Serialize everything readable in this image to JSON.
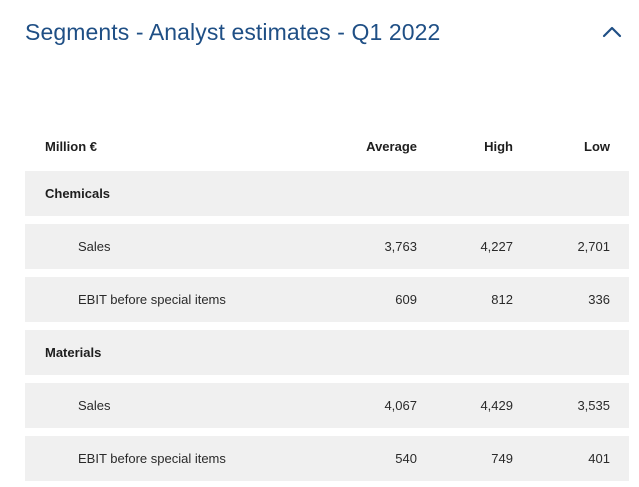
{
  "title": "Segments - Analyst estimates - Q1 2022",
  "table": {
    "headers": {
      "label": "Million €",
      "average": "Average",
      "high": "High",
      "low": "Low"
    },
    "groups": [
      {
        "name": "Chemicals",
        "rows": [
          {
            "label": "Sales",
            "average": "3,763",
            "high": "4,227",
            "low": "2,701"
          },
          {
            "label": "EBIT before special items",
            "average": "609",
            "high": "812",
            "low": "336"
          }
        ]
      },
      {
        "name": "Materials",
        "rows": [
          {
            "label": "Sales",
            "average": "4,067",
            "high": "4,429",
            "low": "3,535"
          },
          {
            "label": "EBIT before special items",
            "average": "540",
            "high": "749",
            "low": "401"
          }
        ]
      }
    ]
  },
  "colors": {
    "title": "#1f4f85",
    "row_background": "#f0f0f0"
  },
  "icons": {
    "collapse": "chevron-up-icon"
  }
}
